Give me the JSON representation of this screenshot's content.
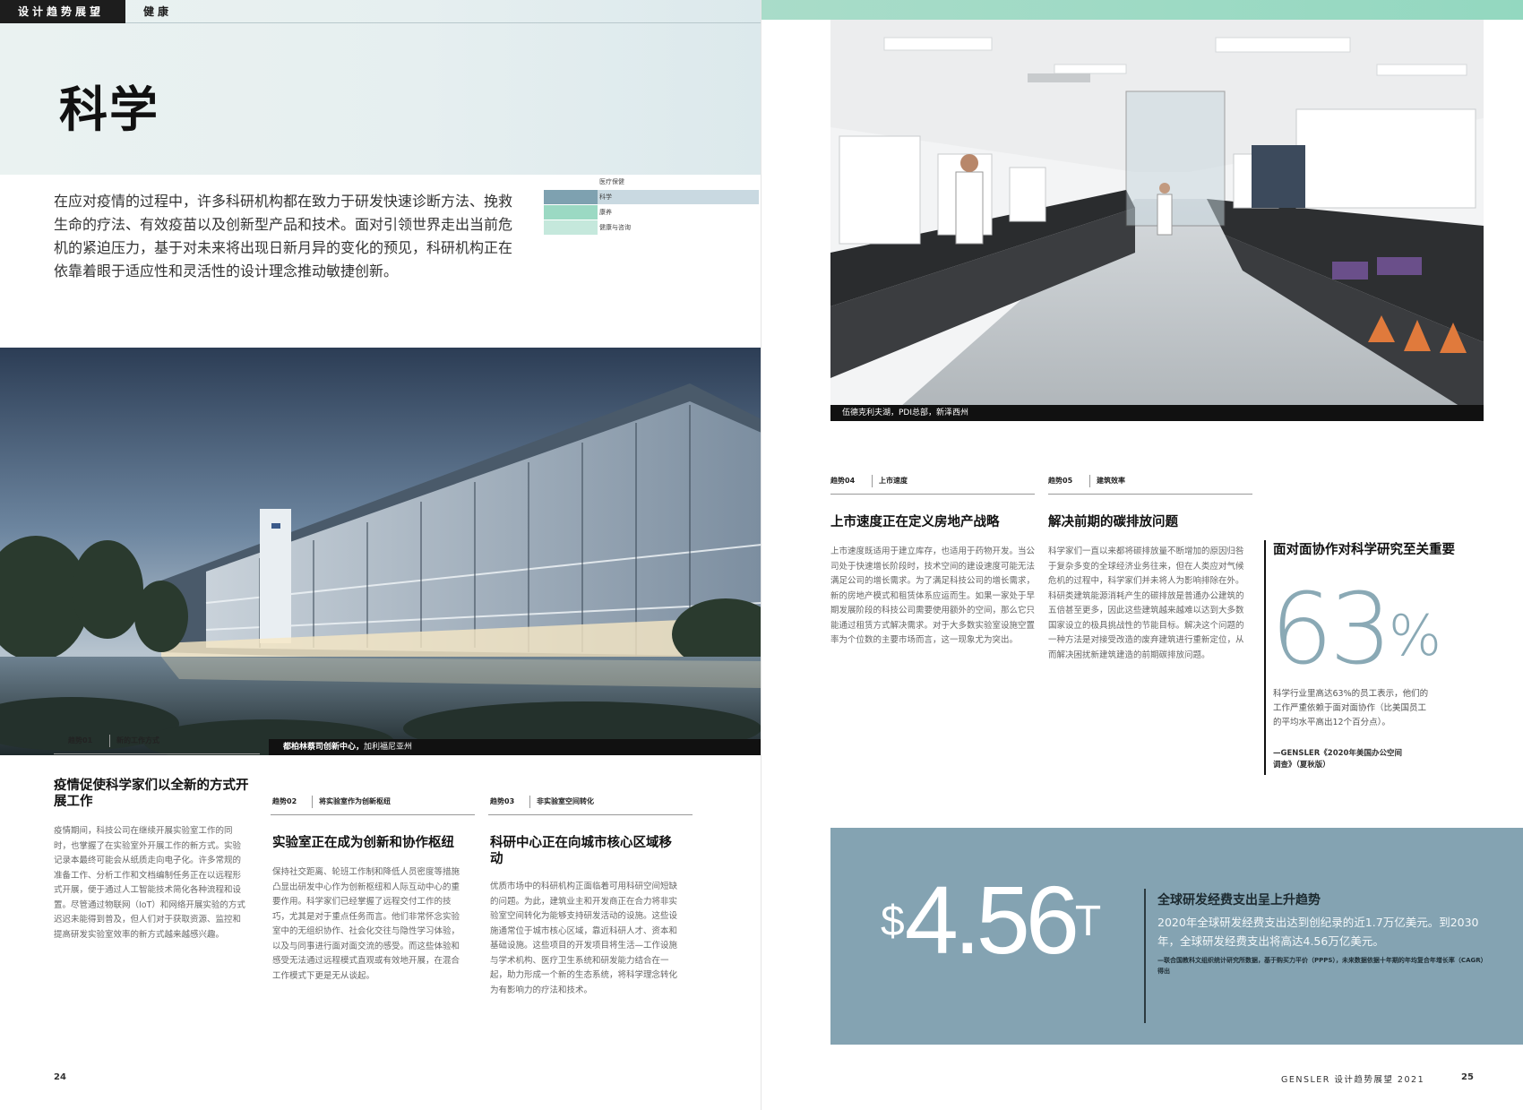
{
  "header": {
    "tab_label": "设计趋势展望",
    "section_label": "健康"
  },
  "page_title": "科学",
  "intro": "在应对疫情的过程中，许多科研机构都在致力于研发快速诊断方法、挽救生命的疗法、有效疫苗以及创新型产品和技术。面对引领世界走出当前危机的紧迫压力，基于对未来将出现日新月异的变化的预见，科研机构正在依靠着眼于适应性和灵活性的设计理念推动敏捷创新。",
  "mini_nav": [
    {
      "label": "医疗保健",
      "color": "#ffffff"
    },
    {
      "label": "科学",
      "color": "#7ea1b0"
    },
    {
      "label": "康养",
      "color": "#9bd9c3"
    },
    {
      "label": "健康与咨询",
      "color": "#c5e8dc"
    }
  ],
  "building_caption": {
    "bold": "都柏林蔡司创新中心，",
    "rest": "加利福尼亚州"
  },
  "trends": [
    {
      "num": "趋势01",
      "name": "新的工作方式",
      "title": "疫情促使科学家们以全新的方式开展工作",
      "body": "疫情期间，科技公司在继续开展实验室工作的同时，也掌握了在实验室外开展工作的新方式。实验记录本最终可能会从纸质走向电子化。许多常规的准备工作、分析工作和文档编制任务正在以远程形式开展，便于通过人工智能技术简化各种流程和设置。尽管通过物联网（IoT）和网络开展实验的方式迟迟未能得到普及，但人们对于获取资源、监控和提高研发实验室效率的新方式越来越感兴趣。"
    },
    {
      "num": "趋势02",
      "name": "将实验室作为创新枢纽",
      "title": "实验室正在成为创新和协作枢纽",
      "body": "保持社交距离、轮班工作制和降低人员密度等措施凸显出研发中心作为创新枢纽和人际互动中心的重要作用。科学家们已经掌握了远程交付工作的技巧，尤其是对于重点任务而言。他们非常怀念实验室中的无组织协作、社会化交往与隐性学习体验，以及与同事进行面对面交流的感受。而这些体验和感受无法通过远程模式直观或有效地开展，在混合工作模式下更是无从谈起。"
    },
    {
      "num": "趋势03",
      "name": "非实验室空间转化",
      "title": "科研中心正在向城市核心区域移动",
      "body": "优质市场中的科研机构正面临着可用科研空间短缺的问题。为此，建筑业主和开发商正在合力将非实验室空间转化为能够支持研发活动的设施。这些设施通常位于城市核心区域，靠近科研人才、资本和基础设施。这些项目的开发项目将生活—工作设施与学术机构、医疗卫生系统和研发能力结合在一起，助力形成一个新的生态系统，将科学理念转化为有影响力的疗法和技术。"
    },
    {
      "num": "趋势04",
      "name": "上市速度",
      "title": "上市速度正在定义房地产战略",
      "body": "上市速度既适用于建立库存，也适用于药物开发。当公司处于快速增长阶段时，技术空间的建设速度可能无法满足公司的增长需求。为了满足科技公司的增长需求，新的房地产模式和租赁体系应运而生。如果一家处于早期发展阶段的科技公司需要使用额外的空间，那么它只能通过租赁方式解决需求。对于大多数实验室设施空置率为个位数的主要市场而言，这一现象尤为突出。"
    },
    {
      "num": "趋势05",
      "name": "建筑效率",
      "title": "解决前期的碳排放问题",
      "body": "科学家们一直以来都将碳排放量不断增加的原因归咎于复杂多变的全球经济业务往来，但在人类应对气候危机的过程中，科学家们并未将人为影响排除在外。科研类建筑能源消耗产生的碳排放是普通办公建筑的五倍甚至更多，因此这些建筑越来越难以达到大多数国家设立的极具挑战性的节能目标。解决这个问题的一种方法是对接受改造的废弃建筑进行重新定位，从而解决困扰新建筑建造的前期碳排放问题。"
    }
  ],
  "lab_caption": "伍德克利夫湖，PDI总部，新泽西州",
  "stat": {
    "heading": "面对面协作对科学研究至关重要",
    "value": "63",
    "unit": "%",
    "description": "科学行业里高达63%的员工表示，他们的工作严重依赖于面对面协作（比美国员工的平均水平高出12个百分点）。",
    "source": "—GENSLER《2020年美国办公空间调查》（夏秋版）"
  },
  "rd": {
    "currency": "$",
    "value": "4.56",
    "unit": "T",
    "title": "全球研发经费支出呈上升趋势",
    "text": "2020年全球研发经费支出达到创纪录的近1.7万亿美元。到2030年，全球研发经费支出将高达4.56万亿美元。",
    "source": "—联合国教科文组织统计研究所数据，基于购买力平价（PPPS），未来数据依据十年期的年均复合年增长率（CAGR）得出"
  },
  "footer": {
    "left_page_num": "24",
    "right_page_num": "25",
    "running_title": "GENSLER 设计趋势展望  2021"
  },
  "colors": {
    "accent_blue": "#84a3b2",
    "accent_mint": "#9bd9c3",
    "stat_color": "#8aa9b5"
  }
}
